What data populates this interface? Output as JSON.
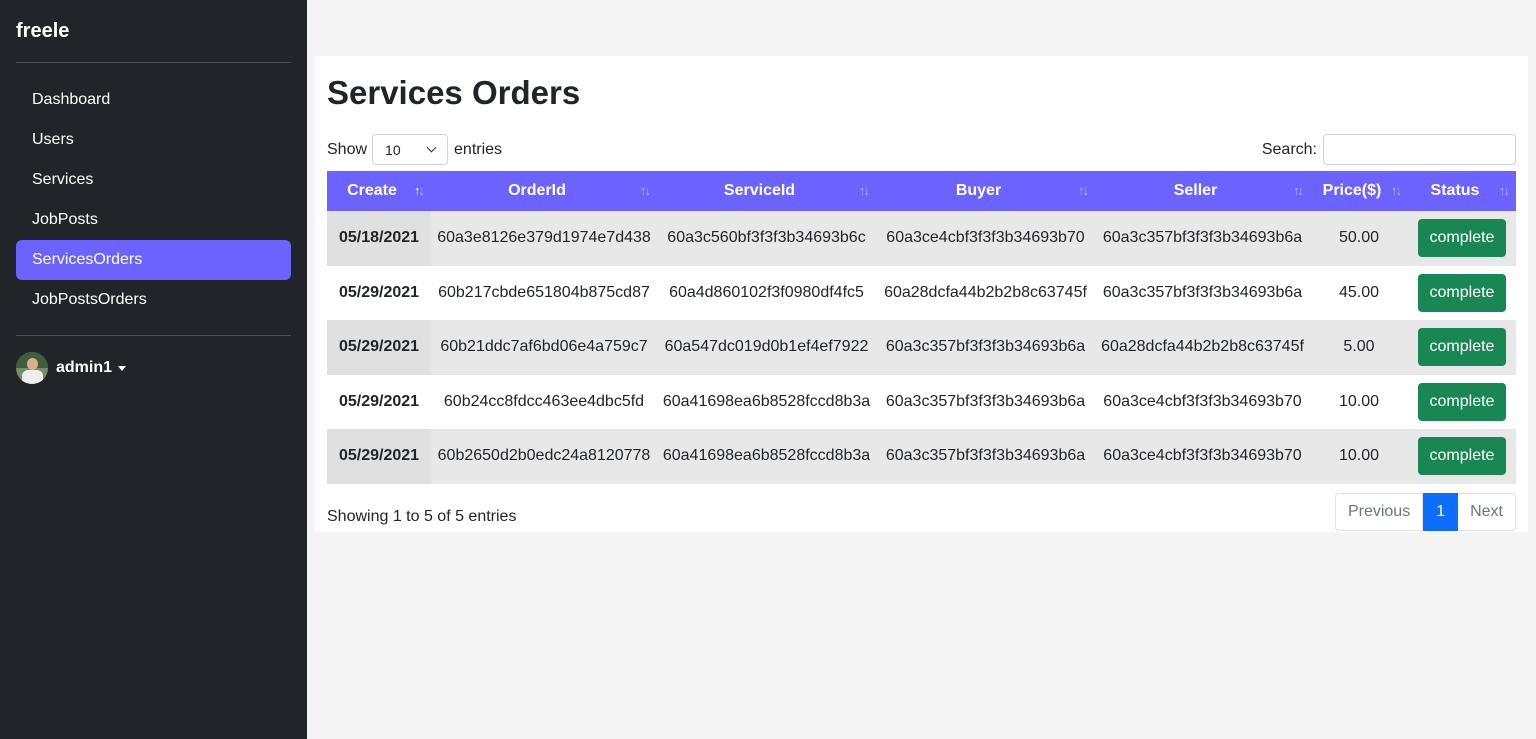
{
  "sidebar": {
    "brand": "freele",
    "items": [
      {
        "label": "Dashboard",
        "active": false
      },
      {
        "label": "Users",
        "active": false
      },
      {
        "label": "Services",
        "active": false
      },
      {
        "label": "JobPosts",
        "active": false
      },
      {
        "label": "ServicesOrders",
        "active": true
      },
      {
        "label": "JobPostsOrders",
        "active": false
      }
    ],
    "user": {
      "name": "admin1"
    }
  },
  "main": {
    "title": "Services Orders",
    "length": {
      "show_label": "Show",
      "value": "10",
      "entries_label": "entries"
    },
    "search": {
      "label": "Search:",
      "value": "",
      "placeholder": ""
    },
    "table": {
      "headers": [
        "Create",
        "OrderId",
        "ServiceId",
        "Buyer",
        "Seller",
        "Price($)",
        "Status"
      ],
      "rows": [
        [
          "05/18/2021",
          "60a3e8126e379d1974e7d438",
          "60a3c560bf3f3f3b34693b6c",
          "60a3ce4cbf3f3f3b34693b70",
          "60a3c357bf3f3f3b34693b6a",
          "50.00",
          "complete"
        ],
        [
          "05/29/2021",
          "60b217cbde651804b875cd87",
          "60a4d860102f3f0980df4fc5",
          "60a28dcfa44b2b2b8c63745f",
          "60a3c357bf3f3f3b34693b6a",
          "45.00",
          "complete"
        ],
        [
          "05/29/2021",
          "60b21ddc7af6bd06e4a759c7",
          "60a547dc019d0b1ef4ef7922",
          "60a3c357bf3f3f3b34693b6a",
          "60a28dcfa44b2b2b8c63745f",
          "5.00",
          "complete"
        ],
        [
          "05/29/2021",
          "60b24cc8fdcc463ee4dbc5fd",
          "60a41698ea6b8528fccd8b3a",
          "60a3c357bf3f3f3b34693b6a",
          "60a3ce4cbf3f3f3b34693b70",
          "10.00",
          "complete"
        ],
        [
          "05/29/2021",
          "60b2650d2b0edc24a8120778",
          "60a41698ea6b8528fccd8b3a",
          "60a3c357bf3f3f3b34693b6a",
          "60a3ce4cbf3f3f3b34693b70",
          "10.00",
          "complete"
        ]
      ]
    },
    "info": "Showing 1 to 5 of 5 entries",
    "pagination": {
      "previous": "Previous",
      "current": "1",
      "next": "Next"
    }
  },
  "colors": {
    "sidebar_bg": "#212529",
    "accent": "#6c63ff",
    "status_green": "#198754",
    "page_blue": "#0d6efd"
  },
  "icons": {
    "sort": "sort-arrows-icon",
    "select": "chevron-down-icon",
    "user_menu": "caret-down-icon"
  }
}
